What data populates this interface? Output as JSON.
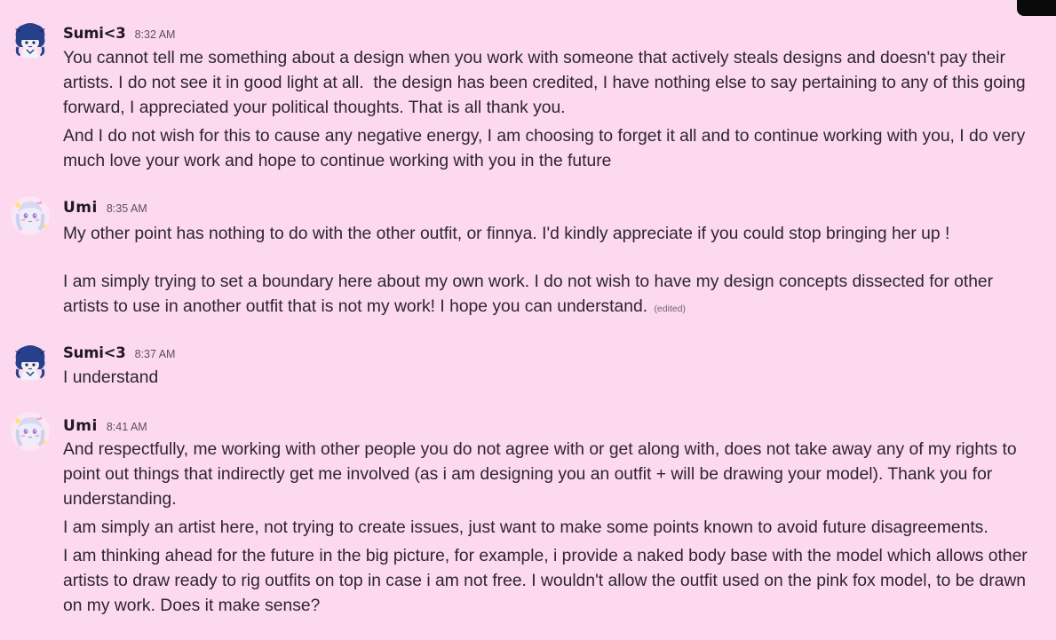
{
  "messages": [
    {
      "author": "Sumi<3",
      "time": "8:32 AM",
      "avatar_icon": "blue-chibi-avatar-icon",
      "lines": [
        "You cannot tell me something about a design when you work with someone that actively steals designs and doesn't pay their artists. I do not see it in good light at all.  the design has been credited, I have nothing else to say pertaining to any of this going forward, I appreciated your political thoughts. That is all thank you.",
        "And I do not wish for this to cause any negative energy, I am choosing to forget it all and to continue working with you, I do very much love your work and hope to continue working with you in the future"
      ]
    },
    {
      "author": "Umi",
      "time": "8:35 AM",
      "avatar_icon": "pastel-anime-avatar-icon",
      "lines": [
        "My other point has nothing to do with the other outfit, or finnya. I'd kindly appreciate if you could stop bringing her up !",
        "I am simply trying to set a boundary here about my own work. I do not wish to have my design concepts dissected for other artists to use in another outfit that is not my work! I hope you can understand."
      ],
      "edited_label": "(edited)"
    },
    {
      "author": "Sumi<3",
      "time": "8:37 AM",
      "avatar_icon": "blue-chibi-avatar-icon",
      "lines": [
        "I understand"
      ]
    },
    {
      "author": "Umi",
      "time": "8:41 AM",
      "avatar_icon": "pastel-anime-avatar-icon",
      "lines": [
        "And respectfully, me working with other people you do not agree with or get along with, does not take away any of my rights to point out things that indirectly get me involved (as i am designing you an outfit + will be drawing your model). Thank you for understanding.",
        "I am simply an artist here, not trying to create issues, just want to make some points known to avoid future disagreements.",
        "I am thinking ahead for the future in the big picture, for example, i provide a naked body base with the model which allows other artists to draw ready to rig outfits on top in case i am not free. I wouldn't allow the outfit used on the pink fox model, to be drawn on my work. Does it make sense?"
      ]
    }
  ],
  "colors": {
    "background": "#fdd9f0",
    "text": "#2d2530",
    "timestamp": "#5a4f5c"
  }
}
